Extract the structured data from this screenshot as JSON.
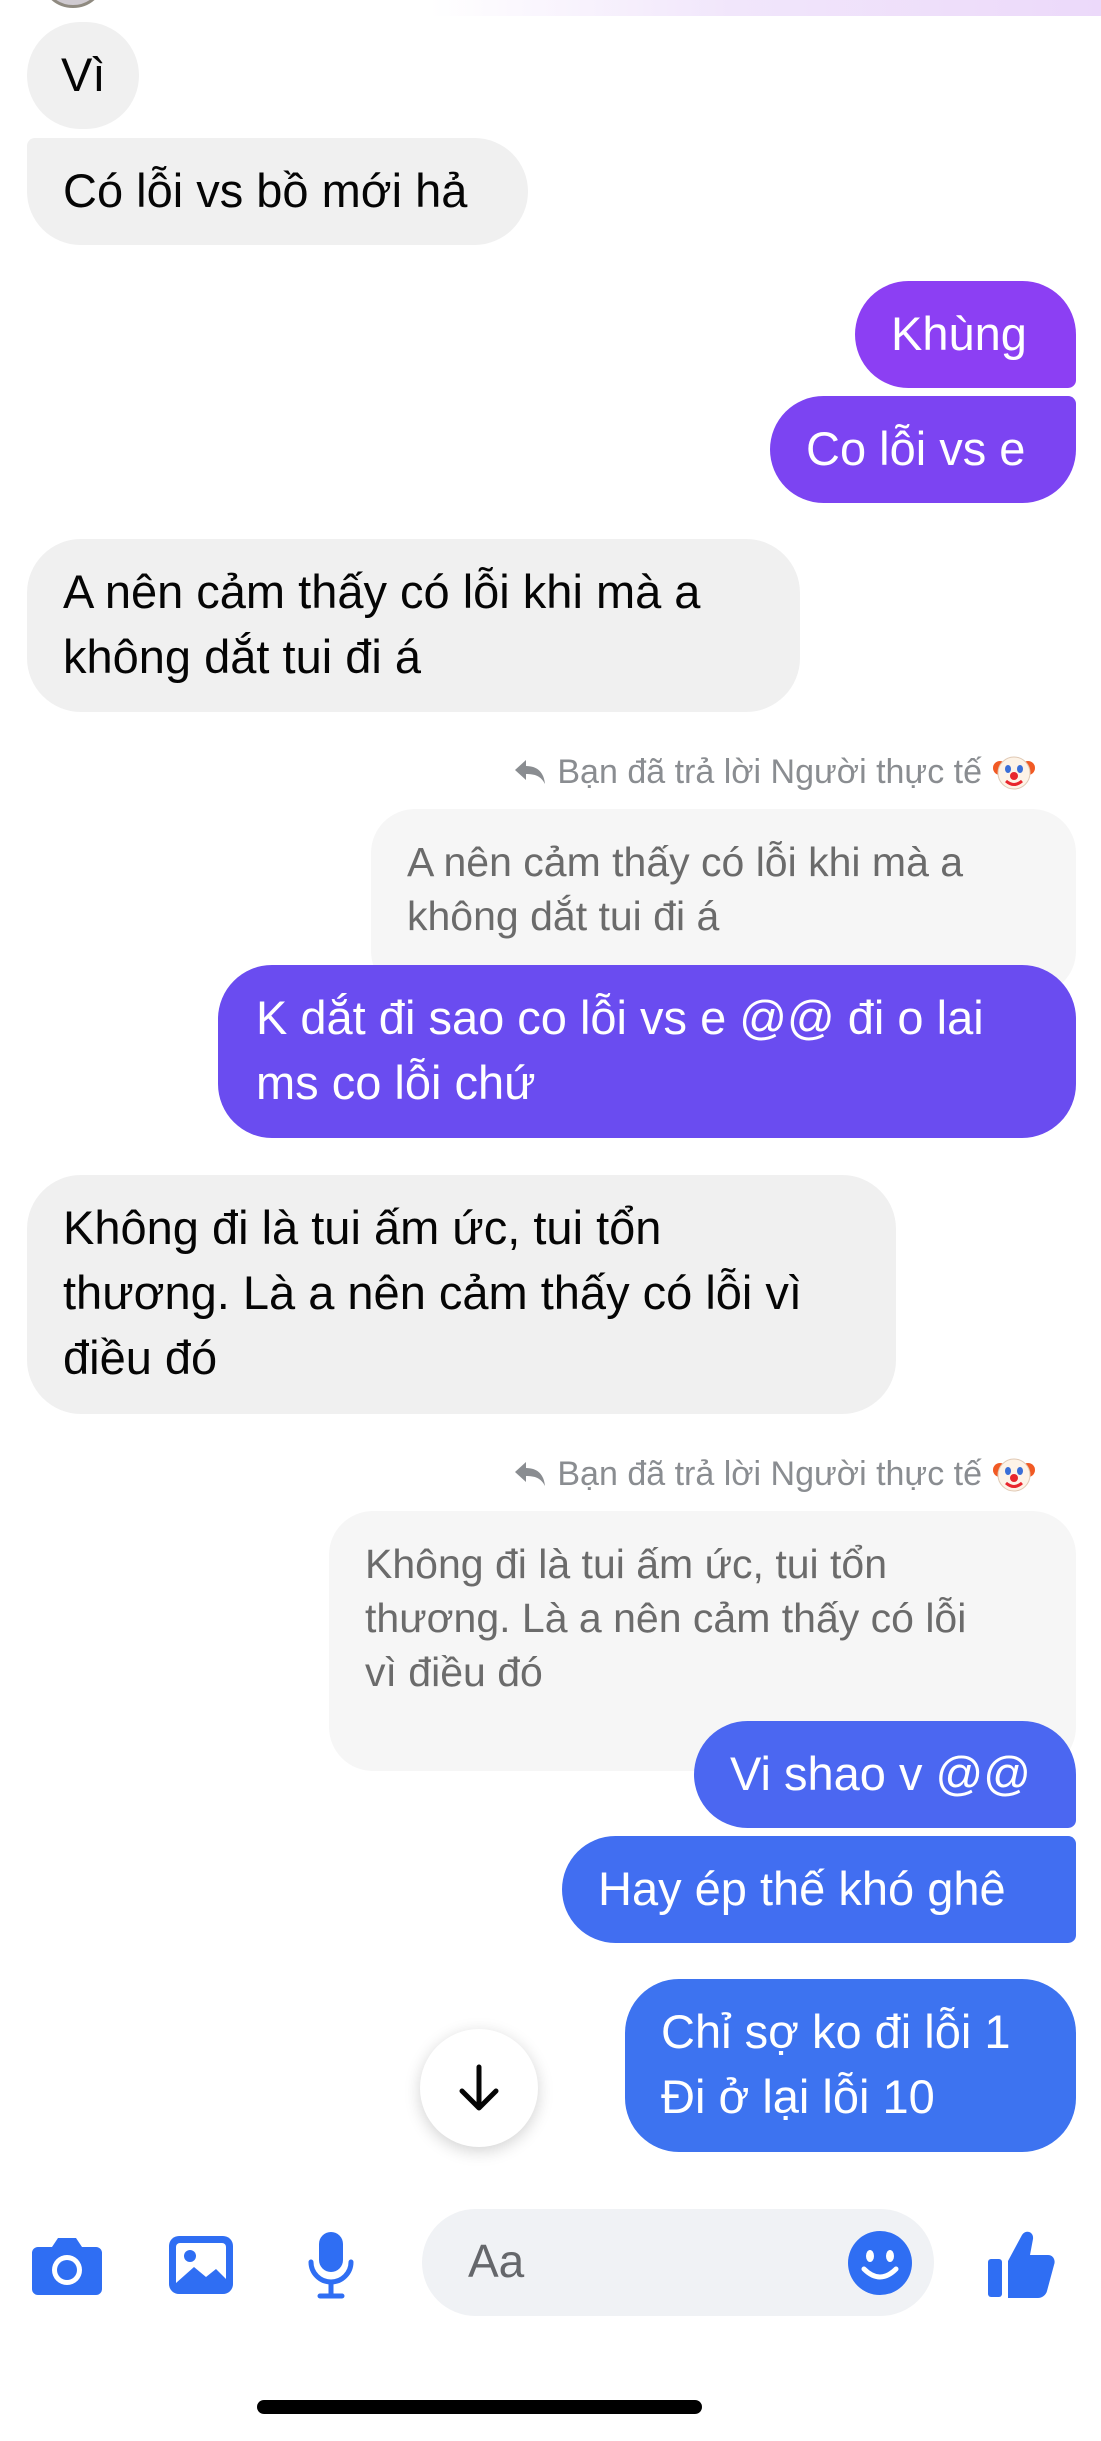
{
  "colors": {
    "incoming_bubble": "#f0f0f0",
    "outgoing_gradient": [
      "#8c3ff3",
      "#6a4cf0",
      "#3d73f0"
    ],
    "accent_blue": "#2f6ef3",
    "reply_label": "#8a8d91"
  },
  "messages": [
    {
      "direction": "in",
      "text": "Vì"
    },
    {
      "direction": "in",
      "text": "Có lỗi vs bồ mới hả"
    },
    {
      "direction": "out",
      "text": "Khùng"
    },
    {
      "direction": "out",
      "text": "Co lỗi vs e"
    },
    {
      "direction": "in",
      "lines": [
        "A nên cảm thấy có lỗi khi mà a",
        "không dắt tui đi á"
      ]
    },
    {
      "direction": "out",
      "reply_label": "Bạn đã trả lời Người thực tế",
      "reply_emoji": "clown-face-icon",
      "quoted_lines": [
        "A nên cảm thấy có lỗi khi mà a",
        "không dắt tui đi á"
      ],
      "lines": [
        "K dắt đi sao co lỗi vs e @@ đi o lai",
        "ms co lỗi chứ"
      ]
    },
    {
      "direction": "in",
      "lines": [
        "Không đi là tui ấm ức, tui tổn",
        "thương. Là a nên cảm thấy có lỗi vì",
        "điều đó"
      ]
    },
    {
      "direction": "out",
      "reply_label": "Bạn đã trả lời Người thực tế",
      "reply_emoji": "clown-face-icon",
      "quoted_lines": [
        "Không đi là tui ấm ức, tui tổn",
        "thương. Là a nên cảm thấy có lỗi",
        "vì điều đó"
      ],
      "text": "Vi shao v @@"
    },
    {
      "direction": "out",
      "text": "Hay ép thế khó ghê"
    },
    {
      "direction": "out",
      "lines": [
        "Chỉ sợ ko đi lỗi 1",
        "Đi ở lại lỗi 10"
      ]
    }
  ],
  "scroll_button": {
    "icon": "arrow-down-icon"
  },
  "composer": {
    "placeholder": "Aa",
    "icons": [
      "camera-icon",
      "gallery-icon",
      "microphone-icon",
      "emoji-icon",
      "thumbs-up-icon"
    ]
  }
}
